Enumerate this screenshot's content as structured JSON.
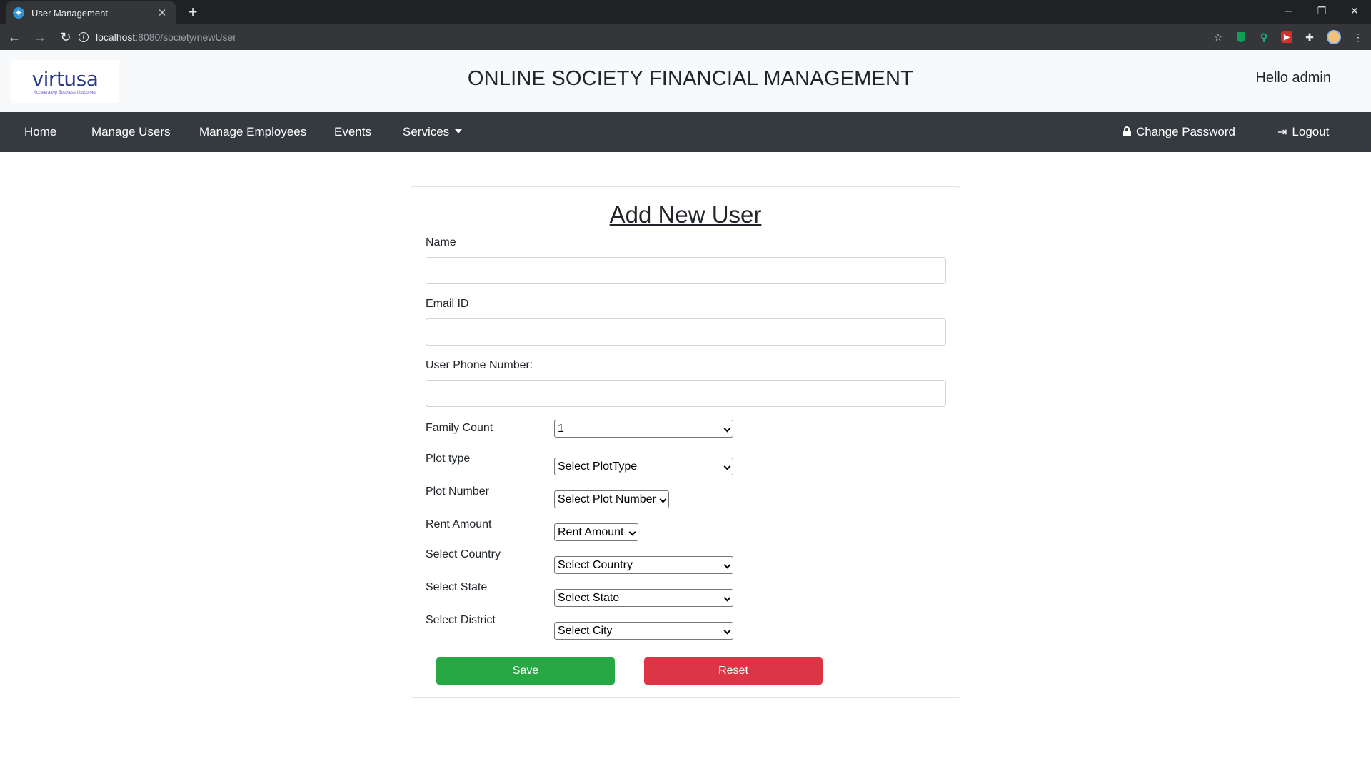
{
  "browser": {
    "tab_title": "User Management",
    "new_tab": "+",
    "url_host": "localhost",
    "url_path": ":8080/society/newUser"
  },
  "header": {
    "logo_text": "virtusa",
    "logo_tagline": "Accelerating Business Outcomes",
    "title": "ONLINE SOCIETY FINANCIAL MANAGEMENT",
    "greeting": "Hello admin"
  },
  "nav": {
    "home": "Home",
    "manage_users": "Manage Users",
    "manage_employees": "Manage Employees",
    "events": "Events",
    "services": "Services",
    "change_password": "Change Password",
    "logout": "Logout"
  },
  "form": {
    "title": "Add New User",
    "name_label": "Name",
    "name_value": "",
    "email_label": "Email ID",
    "email_value": "",
    "phone_label": "User Phone Number:",
    "phone_value": "",
    "family_count_label": "Family Count",
    "family_count_value": "1",
    "plot_type_label": "Plot type",
    "plot_type_value": "Select PlotType",
    "plot_number_label": "Plot Number",
    "plot_number_value": "Select Plot Number",
    "rent_amount_label": "Rent Amount",
    "rent_amount_value": "Rent Amount",
    "country_label": "Select Country",
    "country_value": "Select Country",
    "state_label": "Select State",
    "state_value": "Select State",
    "district_label": "Select District",
    "district_value": "Select City",
    "save_label": "Save",
    "reset_label": "Reset"
  },
  "colors": {
    "navbar": "#343a40",
    "save": "#28a745",
    "reset": "#dc3545"
  }
}
